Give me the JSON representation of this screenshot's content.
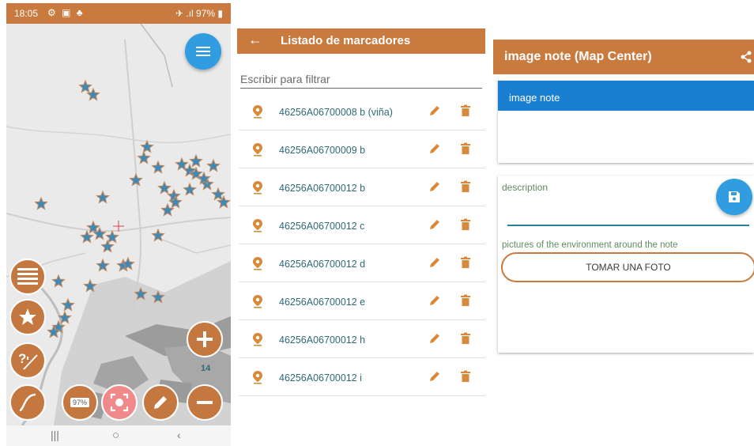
{
  "map_screen": {
    "status_time": "18:05",
    "status_battery": "97%",
    "zoom_level": "14",
    "battery_badge": "97%",
    "icons": {
      "menu": "hamburger-icon",
      "layers": "layers-list-icon",
      "favorites": "star-icon",
      "query": "query-measure-icon",
      "curve": "curve-icon",
      "center": "target-icon",
      "edit": "pencil-icon",
      "zoom_in": "plus-icon",
      "zoom_out": "minus-icon"
    },
    "colors": {
      "accent": "#c4773f",
      "fab": "#2f9de0",
      "star": "#3e89b8"
    }
  },
  "marker_list": {
    "title": "Listado de marcadores",
    "filter_placeholder": "Escribir para filtrar",
    "items": [
      {
        "label": "46256A06700008  b (viña)"
      },
      {
        "label": "46256A06700009  b"
      },
      {
        "label": "46256A06700012  b"
      },
      {
        "label": "46256A06700012  c"
      },
      {
        "label": "46256A06700012  d"
      },
      {
        "label": "46256A06700012  e"
      },
      {
        "label": "46256A06700012  h"
      },
      {
        "label": "46256A06700012  i"
      }
    ]
  },
  "note_screen": {
    "title": "image note (Map Center)",
    "note_name": "image note",
    "description_label": "description",
    "description_value": "",
    "pictures_label": "pictures of the environment around the note",
    "take_photo_button": "TOMAR UNA FOTO",
    "colors": {
      "header": "#c97a3e",
      "name_bar": "#1a7fd1",
      "save_fab": "#2f9de0"
    }
  }
}
